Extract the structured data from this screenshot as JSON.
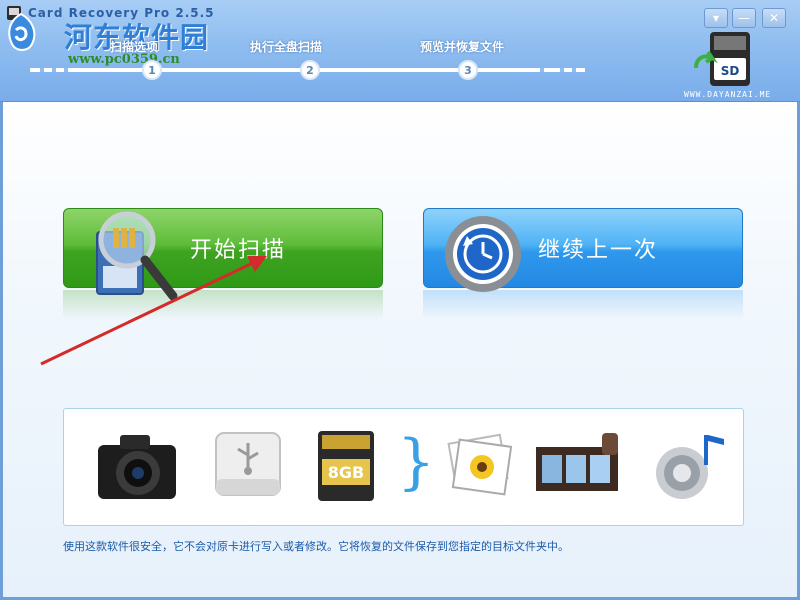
{
  "window": {
    "title": "Card Recovery Pro 2.5.5",
    "buttons": [
      "▾",
      "—",
      "✕"
    ]
  },
  "watermark": {
    "title": "河东软件园",
    "url": "www.pc0359.cn"
  },
  "steps": [
    {
      "label": "扫描选项",
      "number": "1"
    },
    {
      "label": "执行全盘扫描",
      "number": "2"
    },
    {
      "label": "预览并恢复文件",
      "number": "3"
    }
  ],
  "logo": {
    "badge": "SD",
    "caption": "WWW.DAYANZAI.ME"
  },
  "actions": {
    "start_scan": "开始扫描",
    "continue_last": "继续上一次"
  },
  "media_icons": [
    "camera-icon",
    "usb-drive-icon",
    "sd-card-icon",
    "photo-icon",
    "film-icon",
    "music-icon"
  ],
  "sd_card_label": "8GB",
  "info": "使用这款软件很安全，它不会对原卡进行写入或者修改。它将恢复的文件保存到您指定的目标文件夹中。",
  "colors": {
    "header": "#8fbdf0",
    "green_button": "#3ea321",
    "blue_button": "#2f98ec",
    "arrow": "#d42a2a"
  }
}
